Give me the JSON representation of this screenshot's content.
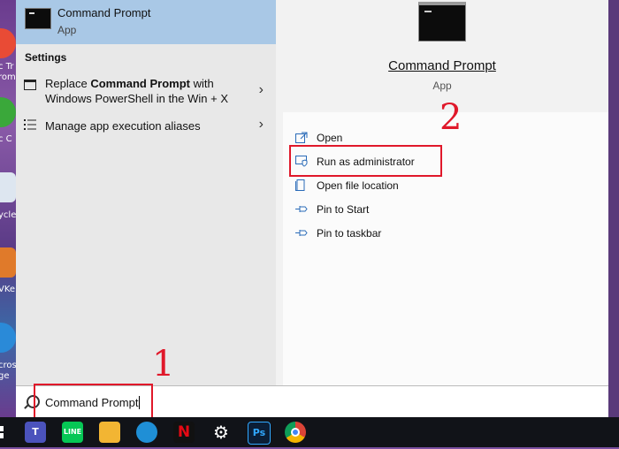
{
  "best_match": {
    "title": "Command Prompt",
    "subtitle": "App"
  },
  "settings": {
    "header": "Settings",
    "items": [
      {
        "pre": "Replace ",
        "bold": "Command Prompt",
        "post": " with Windows PowerShell in the Win + X",
        "icon": "console-icon"
      },
      {
        "text": "Manage app execution aliases",
        "icon": "list-icon"
      }
    ]
  },
  "detail": {
    "title": "Command Prompt",
    "subtitle": "App",
    "actions": [
      {
        "label": "Open",
        "icon": "open-icon"
      },
      {
        "label": "Run as administrator",
        "icon": "shield-icon"
      },
      {
        "label": "Open file location",
        "icon": "folder-icon"
      },
      {
        "label": "Pin to Start",
        "icon": "pin-icon"
      },
      {
        "label": "Pin to taskbar",
        "icon": "pin-icon"
      }
    ]
  },
  "search": {
    "value": "Command Prompt"
  },
  "annotations": {
    "step1": "1",
    "step2": "2"
  },
  "desktop_labels": [
    "c Tr",
    "rom",
    "c C",
    "ycle",
    "VKe",
    "cros",
    "ge"
  ],
  "taskbar": {
    "apps": [
      "windows-icon",
      "teams-icon",
      "line-icon",
      "file-explorer-icon",
      "edge-icon",
      "netflix-icon",
      "settings-icon",
      "photoshop-icon",
      "chrome-icon"
    ],
    "labels": {
      "line": "LINE",
      "netflix": "N",
      "photoshop": "Ps"
    }
  },
  "colors": {
    "highlight": "#e0182a",
    "selected": "#a9c8e6",
    "accent": "#2a6bb8"
  }
}
